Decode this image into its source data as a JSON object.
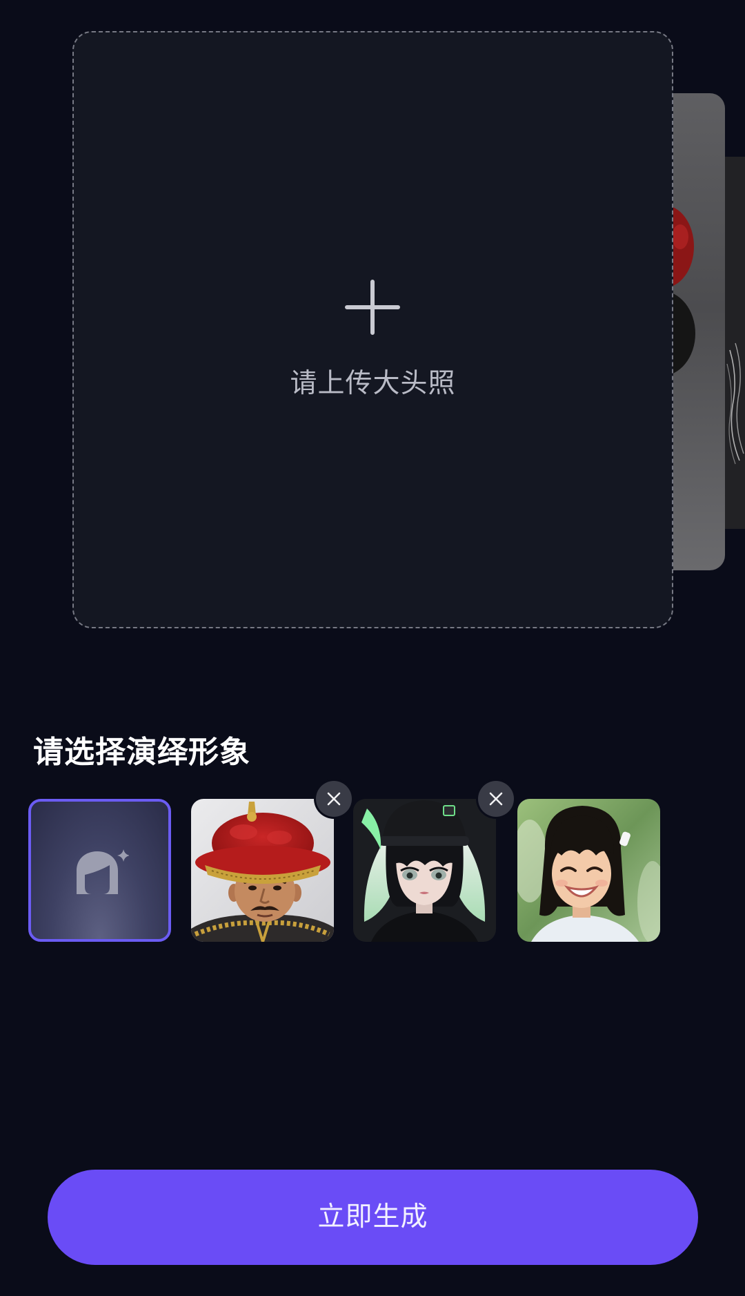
{
  "upload_card": {
    "hint": "请上传大头照",
    "icon": "plus-icon"
  },
  "avatar_picker": {
    "title": "请选择演绎形象",
    "selected_index": 0,
    "remove_icon": "close-icon",
    "items": [
      {
        "icon": "avatar-sparkle-icon",
        "selected": true,
        "removable": false
      },
      {
        "selected": false,
        "removable": true
      },
      {
        "selected": false,
        "removable": true
      },
      {
        "selected": false,
        "removable": false
      }
    ]
  },
  "generate_button": {
    "label": "立即生成"
  },
  "colors": {
    "page_background": "#0a0c19",
    "card_background": "#141722",
    "accent": "#6a4cf6",
    "selected_border": "#6b5cf3",
    "text_primary": "#ffffff",
    "text_secondary": "#b9bbc6",
    "remove_button": "#393b46"
  }
}
